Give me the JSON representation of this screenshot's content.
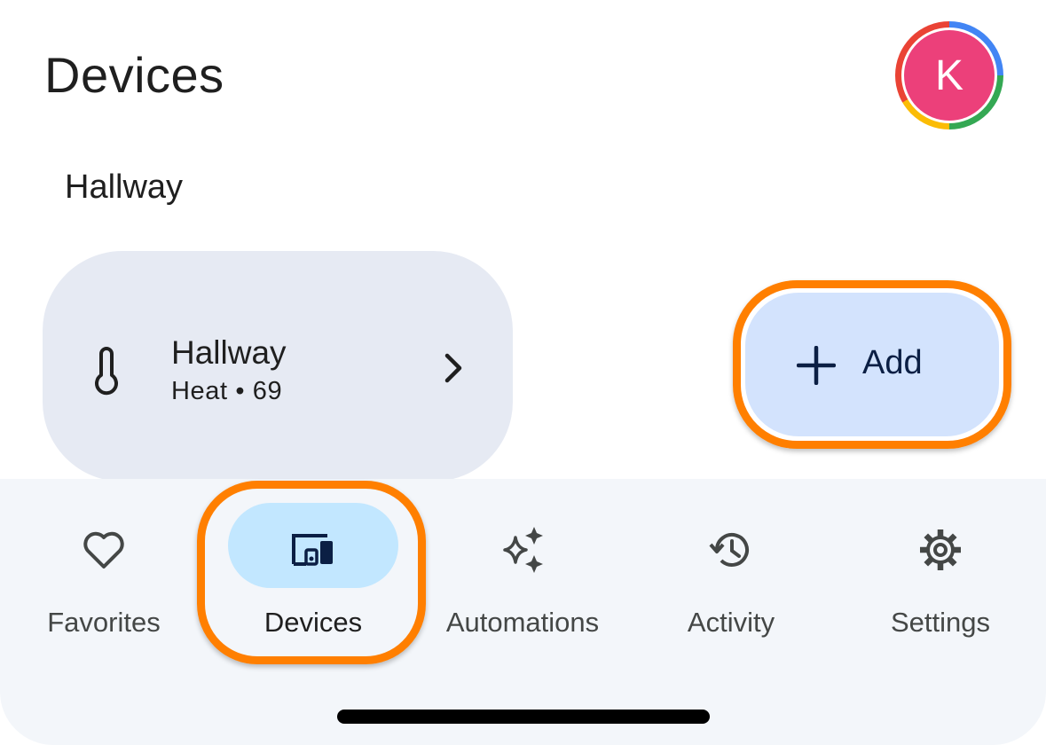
{
  "header": {
    "title": "Devices",
    "avatar_letter": "K"
  },
  "section": {
    "title": "Hallway"
  },
  "device_card": {
    "name": "Hallway",
    "status": "Heat • 69",
    "icon": "thermometer-icon"
  },
  "add_button": {
    "label": "Add",
    "icon": "plus-icon"
  },
  "bottom_nav": {
    "items": [
      {
        "label": "Favorites",
        "icon": "heart-icon"
      },
      {
        "label": "Devices",
        "icon": "devices-icon",
        "selected": true
      },
      {
        "label": "Automations",
        "icon": "sparkle-icon"
      },
      {
        "label": "Activity",
        "icon": "history-icon"
      },
      {
        "label": "Settings",
        "icon": "gear-icon"
      }
    ]
  },
  "colors": {
    "highlight": "#ff7f00",
    "card_bg": "#e6eaf3",
    "add_bg": "#d3e3fd",
    "selected_pill": "#c2e7ff",
    "avatar": "#ec407a"
  }
}
